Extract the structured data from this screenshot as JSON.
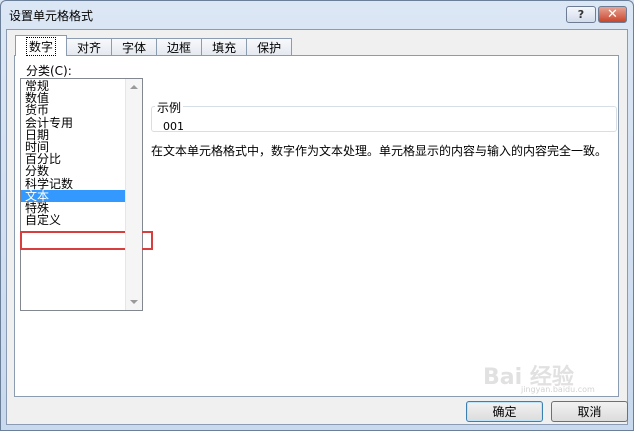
{
  "window": {
    "title": "设置单元格格式"
  },
  "tabs": [
    "数字",
    "对齐",
    "字体",
    "边框",
    "填充",
    "保护"
  ],
  "category": {
    "label": "分类(C):",
    "items": [
      "常规",
      "数值",
      "货币",
      "会计专用",
      "日期",
      "时间",
      "百分比",
      "分数",
      "科学记数",
      "文本",
      "特殊",
      "自定义"
    ],
    "selected": "文本"
  },
  "sample": {
    "legend": "示例",
    "value": "001"
  },
  "description": "在文本单元格格式中，数字作为文本处理。单元格显示的内容与输入的内容完全一致。",
  "buttons": {
    "ok": "确定",
    "cancel": "取消"
  },
  "watermark": {
    "main": "Bai 经验",
    "sub": "jingyan.baidu.com"
  }
}
